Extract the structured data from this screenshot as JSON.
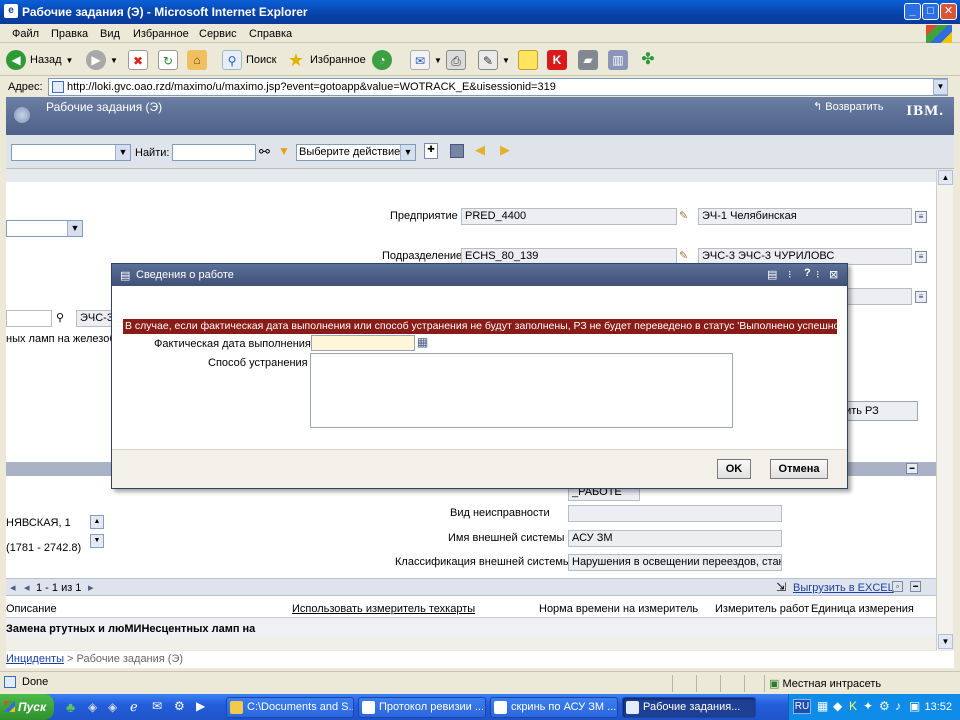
{
  "window": {
    "title": "Рабочие задания (Э) - Microsoft Internet Explorer",
    "minimize": "_",
    "maximize": "□",
    "close": "✕"
  },
  "menu": [
    "Файл",
    "Правка",
    "Вид",
    "Избранное",
    "Сервис",
    "Справка"
  ],
  "toolbar": {
    "back": "Назад",
    "search": "Поиск",
    "favorites": "Избранное"
  },
  "address": {
    "label": "Адрес:",
    "url": "http://loki.gvc.oao.rzd/maximo/u/maximo.jsp?event=gotoapp&value=WOTRACK_E&uisessionid=319"
  },
  "app": {
    "title": "Рабочие задания (Э)",
    "return_label": "Возвратить",
    "brand": "IBM.",
    "find_label": "Найти:",
    "action_select": "Выберите действие"
  },
  "form": {
    "enterprise_label": "Предприятие",
    "enterprise_code": "PRED_4400",
    "enterprise_name": "ЭЧ-1 Челябинская",
    "division_label": "Подразделение",
    "division_code": "ECHS_80_139",
    "division_name": "ЭЧС-3 ЭЧС-3 ЧУРИЛОВС",
    "left_code": "ЭЧС-3",
    "left_text": "ных ламп на железобе",
    "right_button": "нить РЗ",
    "status_value": "_РАБОТЕ",
    "fault_type_label": "Вид неисправности",
    "fault_type_value": "",
    "ext_system_label": "Имя внешней системы",
    "ext_system_value": "АСУ ЗМ",
    "ext_class_label": "Классификация внешней системы",
    "ext_class_value": "Нарушения в освещении переездов, станци",
    "address_line1": "НЯВСКАЯ, 1",
    "address_line2": "(1781 - 2742.8)"
  },
  "table": {
    "pager": "1 - 1 из 1",
    "export": "Выгрузить в EXCEL",
    "columns": [
      "Описание",
      "Использовать измеритель техкарты",
      "Норма времени на измеритель",
      "Измеритель работ",
      "Единица измерения"
    ],
    "rows": [
      [
        "Замена ртутных и люМИНесцентных ламп на"
      ]
    ]
  },
  "breadcrumb": {
    "parent": "Инциденты",
    "current": "Рабочие задания (Э)"
  },
  "statusbar": {
    "state": "Done",
    "zone": "Местная интрасеть"
  },
  "dialog": {
    "title": "Сведения о работе",
    "warning": "В случае, если фактическая дата выполнения или способ устранения не будут заполнены, РЗ не будет переведено в статус 'Выполнено успешно'",
    "actual_date_label": "Фактическая дата выполнения",
    "actual_date_value": "",
    "method_label": "Способ устранения",
    "method_value": "",
    "ok": "OK",
    "cancel": "Отмена"
  },
  "taskbar": {
    "start": "Пуск",
    "tasks": [
      "C:\\Documents and S...",
      "Протокол ревизии ...",
      "скринь по АСУ ЗМ ...",
      "Рабочие задания..."
    ],
    "lang": "RU",
    "clock": "13:52"
  },
  "colors": {
    "warning_bg": "#8a1c17",
    "app_header": "#4d6189",
    "taskbar": "#245edb"
  }
}
